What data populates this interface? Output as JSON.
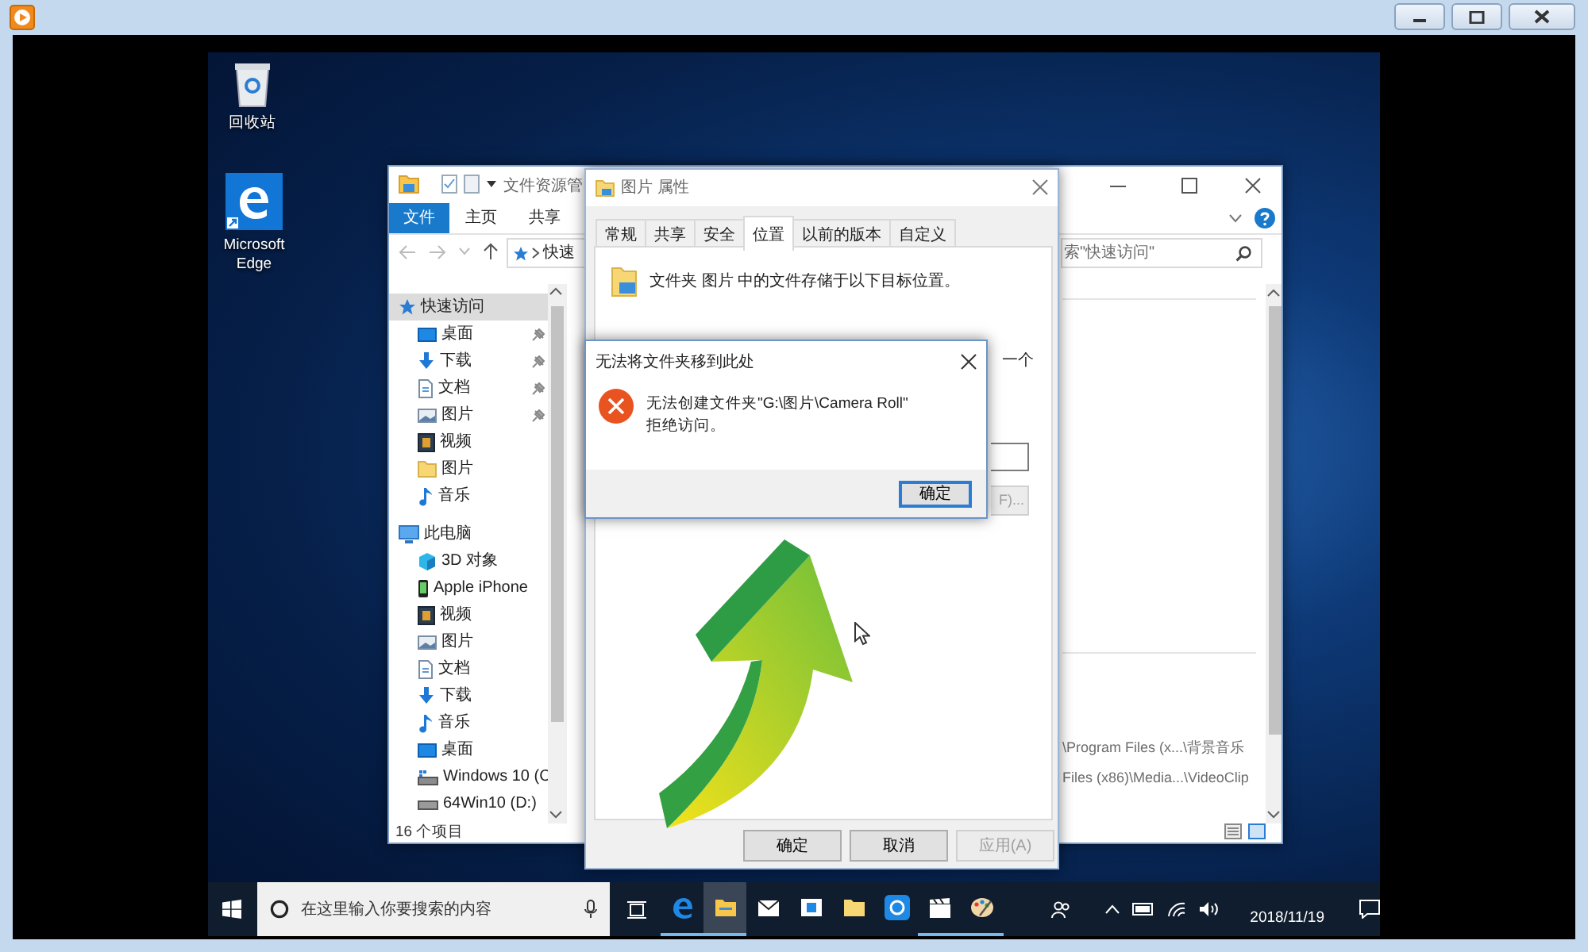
{
  "desktop": {
    "icons": [
      {
        "kind": "recycle-bin",
        "label": "回收站"
      },
      {
        "kind": "edge",
        "label": "Microsoft Edge"
      }
    ]
  },
  "explorer": {
    "title": "文件资源管",
    "ribbon_tabs": [
      {
        "label": "文件",
        "selected": true
      },
      {
        "label": "主页",
        "selected": false
      },
      {
        "label": "共享",
        "selected": false
      }
    ],
    "address": "快速",
    "search_placeholder": "索\"快速访问\"",
    "navigation": [
      {
        "label": "快速访问",
        "kind": "star",
        "selected": true,
        "children": [
          {
            "label": "桌面",
            "kind": "desktop",
            "pinned": true,
            "selected": false
          },
          {
            "label": "下载",
            "kind": "download",
            "pinned": true,
            "selected": false
          },
          {
            "label": "文档",
            "kind": "document",
            "pinned": true,
            "selected": false
          },
          {
            "label": "图片",
            "kind": "picture",
            "pinned": true,
            "selected": false
          },
          {
            "label": "视频",
            "kind": "video",
            "pinned": false,
            "selected": false
          },
          {
            "label": "图片",
            "kind": "folder",
            "pinned": false,
            "selected": false
          },
          {
            "label": "音乐",
            "kind": "music",
            "pinned": false,
            "selected": false
          }
        ]
      },
      {
        "label": "此电脑",
        "kind": "computer",
        "selected": false,
        "children": [
          {
            "label": "3D 对象",
            "kind": "cube",
            "selected": false
          },
          {
            "label": "Apple iPhone",
            "kind": "phone",
            "selected": false
          },
          {
            "label": "视频",
            "kind": "video",
            "selected": false
          },
          {
            "label": "图片",
            "kind": "picture",
            "selected": false
          },
          {
            "label": "文档",
            "kind": "document",
            "selected": false
          },
          {
            "label": "下载",
            "kind": "download",
            "selected": false
          },
          {
            "label": "音乐",
            "kind": "music",
            "selected": false
          },
          {
            "label": "桌面",
            "kind": "desktop",
            "selected": false
          },
          {
            "label": "Windows 10 (C",
            "kind": "system-drive",
            "selected": false
          },
          {
            "label": "64Win10 (D:)",
            "kind": "drive",
            "selected": false
          }
        ]
      }
    ],
    "details": [
      "\\Program Files (x...\\背景音乐",
      "Files (x86)\\Media...\\VideoClip"
    ],
    "status": "16 个项目"
  },
  "properties": {
    "title": "图片 属性",
    "tabs": [
      {
        "label": "常规",
        "selected": false
      },
      {
        "label": "共享",
        "selected": false
      },
      {
        "label": "安全",
        "selected": false
      },
      {
        "label": "位置",
        "selected": true
      },
      {
        "label": "以前的版本",
        "selected": false
      },
      {
        "label": "自定义",
        "selected": false
      }
    ],
    "description": "文件夹 图片 中的文件存储于以下目标位置。",
    "partial_text": "一个",
    "partial_button": "F)...",
    "buttons": [
      {
        "label": "确定",
        "disabled": false
      },
      {
        "label": "取消",
        "disabled": false
      },
      {
        "label": "应用(A)",
        "disabled": true
      }
    ]
  },
  "error_dialog": {
    "title": "无法将文件夹移到此处",
    "message_lines": [
      "无法创建文件夹\"G:\\图片\\Camera Roll\"",
      "拒绝访问。"
    ],
    "button": "确定"
  },
  "taskbar": {
    "search_placeholder": "在这里输入你要搜索的内容",
    "apps": [
      {
        "kind": "edge",
        "running": true,
        "active": false
      },
      {
        "kind": "explorer",
        "running": true,
        "active": true
      },
      {
        "kind": "mail",
        "running": false,
        "active": false
      },
      {
        "kind": "window",
        "running": false,
        "active": false
      },
      {
        "kind": "folder",
        "running": false,
        "active": false
      },
      {
        "kind": "app",
        "running": false,
        "active": false
      },
      {
        "kind": "clapper",
        "running": true,
        "active": false
      },
      {
        "kind": "paint",
        "running": true,
        "active": false
      }
    ],
    "date": "2018/11/19"
  }
}
